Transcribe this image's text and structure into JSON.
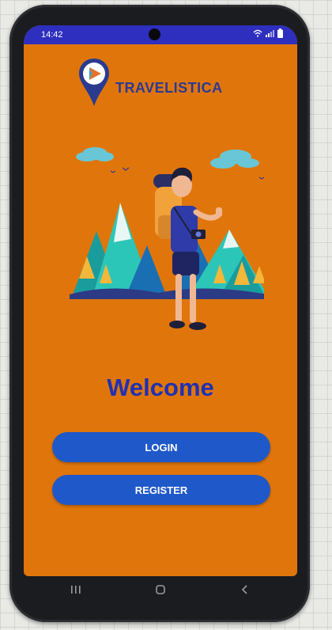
{
  "status_bar": {
    "time": "14:42"
  },
  "app": {
    "brand_name": "TRAVELISTICA"
  },
  "main": {
    "welcome_text": "Welcome",
    "login_label": "LOGIN",
    "register_label": "REGISTER"
  },
  "nav": [
    "recents-icon",
    "home-icon",
    "back-icon"
  ],
  "colors": {
    "screen_bg": "#e0760b",
    "status_bar": "#2e2ebf",
    "brand": "#2c3a93",
    "welcome": "#2131b0",
    "button": "#1f58c9"
  }
}
